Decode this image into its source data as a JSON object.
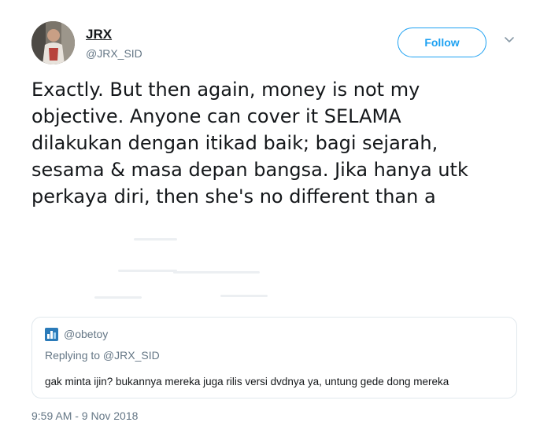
{
  "user": {
    "display_name": "JRX",
    "handle": "@JRX_SID",
    "follow_label": "Follow"
  },
  "tweet": {
    "lines": [
      "Exactly. But then again, money is not my",
      "objective. Anyone can cover it SELAMA",
      "dilakukan dengan itikad baik; bagi sejarah,",
      "sesama & masa depan bangsa. Jika hanya utk",
      "perkaya diri, then she's no different than a"
    ],
    "timestamp": "9:59 AM - 9 Nov 2018"
  },
  "quoted": {
    "username": "@obetoy",
    "replying_to": "Replying to @JRX_SID",
    "text": "gak minta ijin? bukannya mereka juga rilis versi dvdnya ya, untung gede dong mereka"
  },
  "icons": {
    "menu": "chevron-down-icon",
    "quoted_user": "user-badge-icon"
  },
  "colors": {
    "accent": "#1da1f2",
    "text_primary": "#14171a",
    "text_secondary": "#657786",
    "border": "#e1e8ed"
  }
}
